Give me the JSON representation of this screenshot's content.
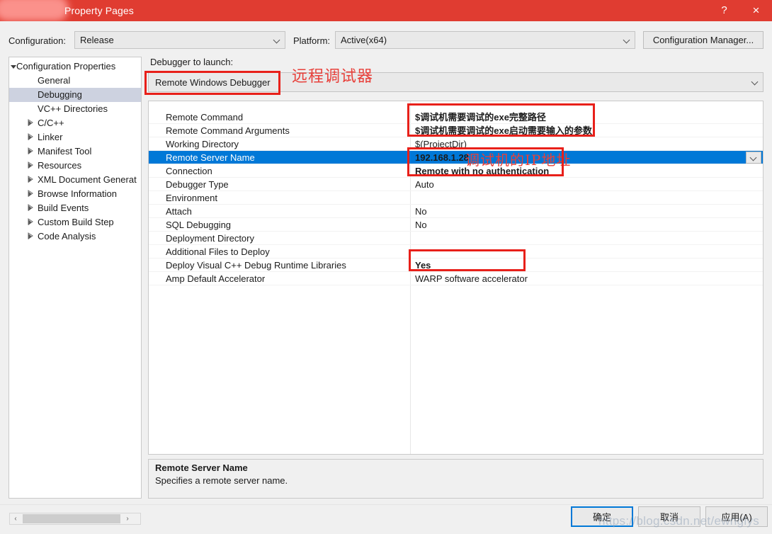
{
  "window": {
    "title": "Property Pages",
    "titlebar_color": "#e03c31",
    "help_icon": "?",
    "close_icon": "×"
  },
  "config_bar": {
    "configuration_label": "Configuration:",
    "configuration_value": "Release",
    "platform_label": "Platform:",
    "platform_value": "Active(x64)",
    "configuration_manager_label": "Configuration Manager..."
  },
  "tree": {
    "items": [
      {
        "label": "Configuration Properties",
        "indent": 10,
        "marker": "expanded",
        "selected": false
      },
      {
        "label": "General",
        "indent": 40,
        "marker": "none",
        "selected": false
      },
      {
        "label": "Debugging",
        "indent": 40,
        "marker": "none",
        "selected": true
      },
      {
        "label": "VC++ Directories",
        "indent": 40,
        "marker": "none",
        "selected": false
      },
      {
        "label": "C/C++",
        "indent": 40,
        "marker": "collapsed",
        "selected": false
      },
      {
        "label": "Linker",
        "indent": 40,
        "marker": "collapsed",
        "selected": false
      },
      {
        "label": "Manifest Tool",
        "indent": 40,
        "marker": "collapsed",
        "selected": false
      },
      {
        "label": "Resources",
        "indent": 40,
        "marker": "collapsed",
        "selected": false
      },
      {
        "label": "XML Document Generat",
        "indent": 40,
        "marker": "collapsed",
        "selected": false
      },
      {
        "label": "Browse Information",
        "indent": 40,
        "marker": "collapsed",
        "selected": false
      },
      {
        "label": "Build Events",
        "indent": 40,
        "marker": "collapsed",
        "selected": false
      },
      {
        "label": "Custom Build Step",
        "indent": 40,
        "marker": "collapsed",
        "selected": false
      },
      {
        "label": "Code Analysis",
        "indent": 40,
        "marker": "collapsed",
        "selected": false
      }
    ],
    "scroll_left_icon": "‹",
    "scroll_right_icon": "›"
  },
  "main": {
    "debugger_to_launch_label": "Debugger to launch:",
    "debugger_to_launch_value": "Remote Windows Debugger",
    "properties": [
      {
        "name": "Remote Command",
        "value": "$调试机需要调试的exe完整路径",
        "bold": true,
        "selected": false,
        "chevron": false
      },
      {
        "name": "Remote Command Arguments",
        "value": "$调试机需要调试的exe启动需要输入的参数",
        "bold": true,
        "selected": false,
        "chevron": false
      },
      {
        "name": "Working Directory",
        "value": "$(ProjectDir)",
        "bold": false,
        "selected": false,
        "chevron": false
      },
      {
        "name": "Remote Server Name",
        "value": "192.168.1.28",
        "bold": true,
        "selected": true,
        "chevron": true
      },
      {
        "name": "Connection",
        "value": "Remote with no authentication",
        "bold": true,
        "selected": false,
        "chevron": false
      },
      {
        "name": "Debugger Type",
        "value": "Auto",
        "bold": false,
        "selected": false,
        "chevron": false
      },
      {
        "name": "Environment",
        "value": "",
        "bold": false,
        "selected": false,
        "chevron": false
      },
      {
        "name": "Attach",
        "value": "No",
        "bold": false,
        "selected": false,
        "chevron": false
      },
      {
        "name": "SQL Debugging",
        "value": "No",
        "bold": false,
        "selected": false,
        "chevron": false
      },
      {
        "name": "Deployment Directory",
        "value": "",
        "bold": false,
        "selected": false,
        "chevron": false
      },
      {
        "name": "Additional Files to Deploy",
        "value": "",
        "bold": false,
        "selected": false,
        "chevron": false
      },
      {
        "name": "Deploy Visual C++ Debug Runtime Libraries",
        "value": "Yes",
        "bold": true,
        "selected": false,
        "chevron": false
      },
      {
        "name": "Amp Default Accelerator",
        "value": "WARP software accelerator",
        "bold": false,
        "selected": false,
        "chevron": false
      }
    ]
  },
  "annotations": {
    "color": "#e8201a",
    "remote_debugger_note": "远程调试器",
    "ip_note": "调试机的IP地址"
  },
  "description": {
    "title": "Remote Server Name",
    "body": "Specifies a remote server name."
  },
  "footer": {
    "ok_label": "确定",
    "cancel_label": "取消",
    "apply_label": "应用(A)",
    "watermark": "https://blog.csdn.net/ewnglys"
  }
}
